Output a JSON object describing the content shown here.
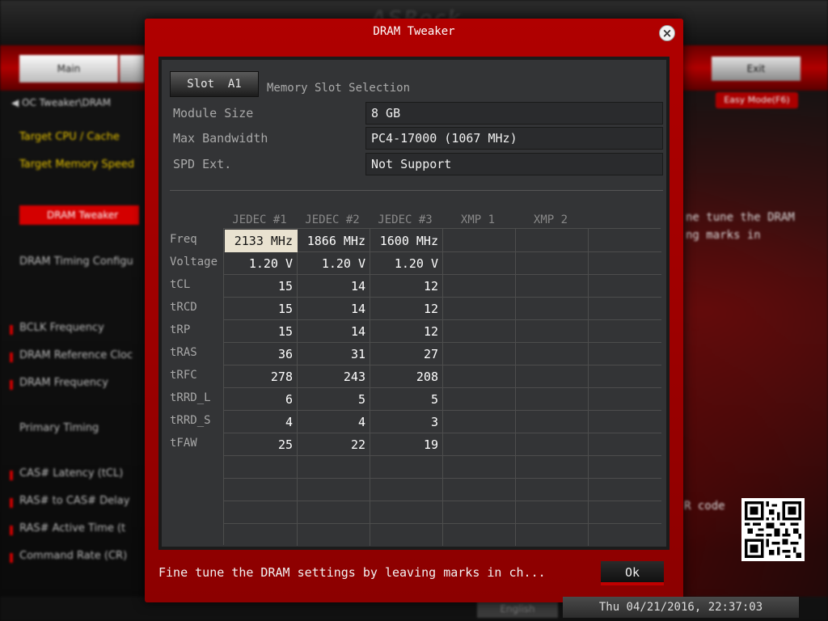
{
  "background": {
    "brand": "ASRock FATALITY",
    "tabs": [
      "Main",
      ""
    ],
    "exit_label": "Exit",
    "breadcrumb": "OC Tweaker\\DRAM",
    "easy_mode_label": "Easy Mode(F6)",
    "menu": {
      "target_cpu": "Target CPU / Cache",
      "target_mem": "Target Memory Speed",
      "dram_tweaker": "DRAM Tweaker",
      "dram_timing": "DRAM Timing Configu",
      "bclk": "BCLK Frequency",
      "dram_ref": "DRAM Reference Cloc",
      "dram_freq": "DRAM Frequency",
      "primary": "Primary Timing",
      "cas": "CAS# Latency (tCL)",
      "ras_cas": "RAS# to CAS# Delay",
      "ras_active": "RAS# Active Time (t",
      "command_rate": "Command Rate (CR)"
    },
    "help_line1": "ne tune the DRAM",
    "help_line2": "ng marks in",
    "qr_label": "R code",
    "language": "English"
  },
  "datetime": "Thu 04/21/2016, 22:37:03",
  "dialog": {
    "title": "DRAM Tweaker",
    "slot_button": "Slot  A1",
    "slot_caption": "Memory Slot Selection",
    "info": [
      {
        "label": "Module Size",
        "value": "8 GB"
      },
      {
        "label": "Max Bandwidth",
        "value": "PC4-17000 (1067 MHz)"
      },
      {
        "label": "SPD Ext.",
        "value": "Not Support"
      }
    ],
    "columns": [
      "JEDEC #1",
      "JEDEC #2",
      "JEDEC #3",
      "XMP 1",
      "XMP 2",
      ""
    ],
    "rows": [
      {
        "label": "Freq",
        "values": [
          "2133 MHz",
          "1866 MHz",
          "1600 MHz"
        ]
      },
      {
        "label": "Voltage",
        "values": [
          "1.20 V",
          "1.20 V",
          "1.20 V"
        ]
      },
      {
        "label": "tCL",
        "values": [
          "15",
          "14",
          "12"
        ]
      },
      {
        "label": "tRCD",
        "values": [
          "15",
          "14",
          "12"
        ]
      },
      {
        "label": "tRP",
        "values": [
          "15",
          "14",
          "12"
        ]
      },
      {
        "label": "tRAS",
        "values": [
          "36",
          "31",
          "27"
        ]
      },
      {
        "label": "tRFC",
        "values": [
          "278",
          "243",
          "208"
        ]
      },
      {
        "label": "tRRD_L",
        "values": [
          "6",
          "5",
          "5"
        ]
      },
      {
        "label": "tRRD_S",
        "values": [
          "4",
          "4",
          "3"
        ]
      },
      {
        "label": "tFAW",
        "values": [
          "25",
          "22",
          "19"
        ]
      }
    ],
    "footer_text": "Fine tune the DRAM settings by leaving marks in ch...",
    "ok_label": "Ok"
  }
}
